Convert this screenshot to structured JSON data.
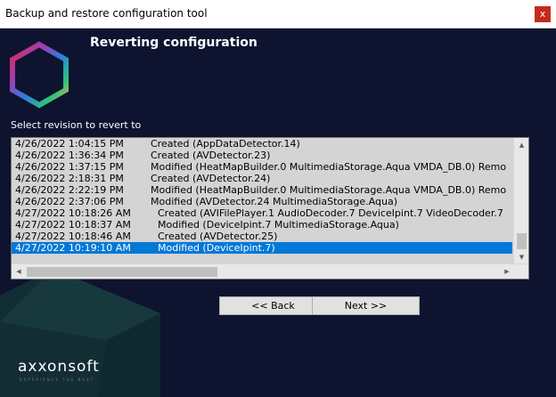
{
  "window": {
    "title": "Backup and restore configuration tool",
    "close_glyph": "x"
  },
  "page": {
    "heading": "Reverting configuration",
    "select_label": "Select revision to revert to"
  },
  "revisions": [
    {
      "date": "4/26/2022 1:04:15 PM",
      "description": "Created (AppDataDetector.14)"
    },
    {
      "date": "4/26/2022 1:36:34 PM",
      "description": "Created (AVDetector.23)"
    },
    {
      "date": "4/26/2022 1:37:15 PM",
      "description": "Modified (HeatMapBuilder.0 MultimediaStorage.Aqua VMDA_DB.0) Remo"
    },
    {
      "date": "4/26/2022 2:18:31 PM",
      "description": "Created (AVDetector.24)"
    },
    {
      "date": "4/26/2022 2:22:19 PM",
      "description": "Modified (HeatMapBuilder.0 MultimediaStorage.Aqua VMDA_DB.0) Remo"
    },
    {
      "date": "4/26/2022 2:37:06 PM",
      "description": "Modified (AVDetector.24 MultimediaStorage.Aqua)"
    },
    {
      "date": "4/27/2022 10:18:26 AM",
      "description": "Created (AVIFilePlayer.1 AudioDecoder.7 DeviceIpint.7 VideoDecoder.7"
    },
    {
      "date": "4/27/2022 10:18:37 AM",
      "description": "Modified (DeviceIpint.7 MultimediaStorage.Aqua)"
    },
    {
      "date": "4/27/2022 10:18:46 AM",
      "description": "Created (AVDetector.25)"
    },
    {
      "date": "4/27/2022 10:19:10 AM",
      "description": "Modified (DeviceIpint.7)"
    }
  ],
  "selected_index": 9,
  "scroll": {
    "up_glyph": "▲",
    "down_glyph": "▼",
    "left_glyph": "◀",
    "right_glyph": "▶"
  },
  "buttons": {
    "back_label": "<< Back",
    "next_label": "Next >>"
  },
  "brand": {
    "name": "axxonsoft",
    "tagline": "EXPERIENCE THE NEXT"
  },
  "colors": {
    "background": "#0e1330",
    "selection": "#0078d7",
    "close_button": "#c42b1c"
  },
  "icons": {
    "logo": "hexagon-logo-icon",
    "close": "close-icon"
  }
}
